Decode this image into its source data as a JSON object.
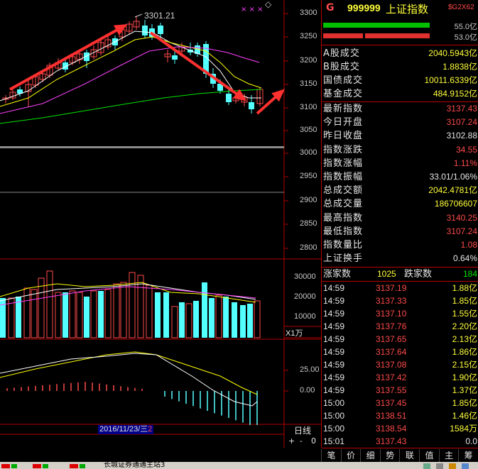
{
  "quote": {
    "code": "999999",
    "name": "上证指数",
    "tag": "G",
    "extra": "$G2X62",
    "bar_up_label": "55.0亿",
    "bar_down_label": "53.0亿",
    "bar_up_fraction": 0.92,
    "bar_down_fraction": 0.92
  },
  "turnover": [
    {
      "label": "A股成交",
      "value": "2040.5943亿"
    },
    {
      "label": "B股成交",
      "value": "1.8838亿"
    },
    {
      "label": "国债成交",
      "value": "10011.6339亿"
    },
    {
      "label": "基金成交",
      "value": "484.9152亿"
    }
  ],
  "stats": [
    {
      "label": "最新指数",
      "value": "3137.43",
      "color": "#ff4a4a"
    },
    {
      "label": "今日开盘",
      "value": "3107.24",
      "color": "#ff4a4a"
    },
    {
      "label": "昨日收盘",
      "value": "3102.88",
      "color": "#e6e6e6"
    },
    {
      "label": "指数涨跌",
      "value": "34.55",
      "color": "#ff4a4a"
    },
    {
      "label": "指数涨幅",
      "value": "1.11%",
      "color": "#ff4a4a"
    },
    {
      "label": "指数振幅",
      "value": "33.01/1.06%",
      "color": "#e6e6e6"
    },
    {
      "label": "总成交额",
      "value": "2042.4781亿",
      "color": "#ffff3c"
    },
    {
      "label": "总成交量",
      "value": "186706607",
      "color": "#ffff3c"
    },
    {
      "label": "最高指数",
      "value": "3140.25",
      "color": "#ff4a4a"
    },
    {
      "label": "最低指数",
      "value": "3107.24",
      "color": "#ff4a4a"
    },
    {
      "label": "指数量比",
      "value": "1.08",
      "color": "#ff4a4a"
    },
    {
      "label": "上证换手",
      "value": "0.64%",
      "color": "#e6e6e6"
    }
  ],
  "updown": {
    "up_label": "涨家数",
    "up_value": "1025",
    "down_label": "跌家数",
    "down_value": "184"
  },
  "ticks": [
    {
      "time": "14:59",
      "price": "3137.19",
      "vol": "1.88亿"
    },
    {
      "time": "14:59",
      "price": "3137.33",
      "vol": "1.85亿"
    },
    {
      "time": "14:59",
      "price": "3137.10",
      "vol": "1.55亿"
    },
    {
      "time": "14:59",
      "price": "3137.76",
      "vol": "2.20亿"
    },
    {
      "time": "14:59",
      "price": "3137.65",
      "vol": "2.13亿"
    },
    {
      "time": "14:59",
      "price": "3137.64",
      "vol": "1.86亿"
    },
    {
      "time": "14:59",
      "price": "3137.08",
      "vol": "2.15亿"
    },
    {
      "time": "14:59",
      "price": "3137.42",
      "vol": "1.90亿"
    },
    {
      "time": "14:59",
      "price": "3137.55",
      "vol": "1.37亿"
    },
    {
      "time": "15:00",
      "price": "3137.45",
      "vol": "1.85亿"
    },
    {
      "time": "15:00",
      "price": "3138.51",
      "vol": "1.46亿"
    },
    {
      "time": "15:00",
      "price": "3138.54",
      "vol": "1584万"
    },
    {
      "time": "15:01",
      "price": "3137.43",
      "vol": "0.0"
    }
  ],
  "tabs": [
    "笔",
    "价",
    "细",
    "势",
    "联",
    "值",
    "主",
    "筹"
  ],
  "chart": {
    "high_label": "3301.21",
    "date_label": "2016/11/23/三",
    "date_suffix": "2",
    "period_label": "日线",
    "vol_unit": "X1万",
    "price_ticks": [
      "3300",
      "3250",
      "3200",
      "3150",
      "3100",
      "3050",
      "3000",
      "2950",
      "2900",
      "2850",
      "2800"
    ],
    "vol_ticks": [
      "30000",
      "20000",
      "10000"
    ],
    "macd_ticks": [
      "25.00",
      "0.00"
    ],
    "zoom_buttons": [
      "+",
      "-",
      "0"
    ],
    "marks": "× × ×",
    "diamond": "◇"
  },
  "status": {
    "text": "长城证券通通主站3"
  },
  "colors": {
    "up": "#ff4a4a",
    "down": "#54ffff",
    "ma5": "#ffffff",
    "ma10": "#ffff00",
    "ma20": "#ff40ff",
    "ma60": "#00e600",
    "bg": "#000000",
    "frame": "#b00000"
  }
}
